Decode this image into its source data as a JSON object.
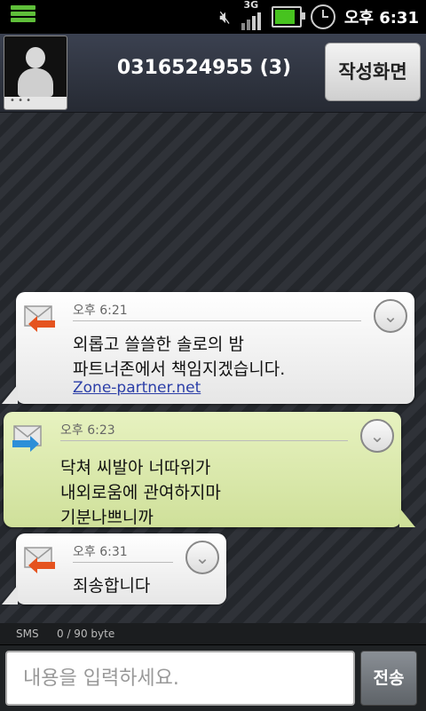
{
  "status_bar": {
    "network": "3G",
    "time": "오후 6:31",
    "colors": {
      "menu_icon": "#5fbf3a",
      "battery": "#47c31f"
    }
  },
  "header": {
    "contact": "0316524955 (3)",
    "compose_label": "작성화면",
    "avatar_dots": "• • •"
  },
  "messages": [
    {
      "direction": "incoming",
      "time": "오후 6:21",
      "lines": [
        "외롭고 쓸쓸한 솔로의 밤",
        "파트너존에서 책임지겠습니다."
      ],
      "link": "Zone-partner.net"
    },
    {
      "direction": "outgoing",
      "time": "오후 6:23",
      "lines": [
        "닥쳐 씨발아 너따위가",
        "내외로움에 관여하지마",
        "기분나쁘니까"
      ]
    },
    {
      "direction": "incoming",
      "time": "오후 6:31",
      "lines": [
        "죄송합니다"
      ]
    }
  ],
  "counter": {
    "type": "SMS",
    "bytes": "0 / 90 byte"
  },
  "input": {
    "placeholder": "내용을 입력하세요.",
    "value": "",
    "send_label": "전송"
  },
  "icons": {
    "incoming_envelope": "envelope-incoming-icon",
    "outgoing_envelope": "envelope-outgoing-icon",
    "expand": "chevron-down-icon"
  }
}
